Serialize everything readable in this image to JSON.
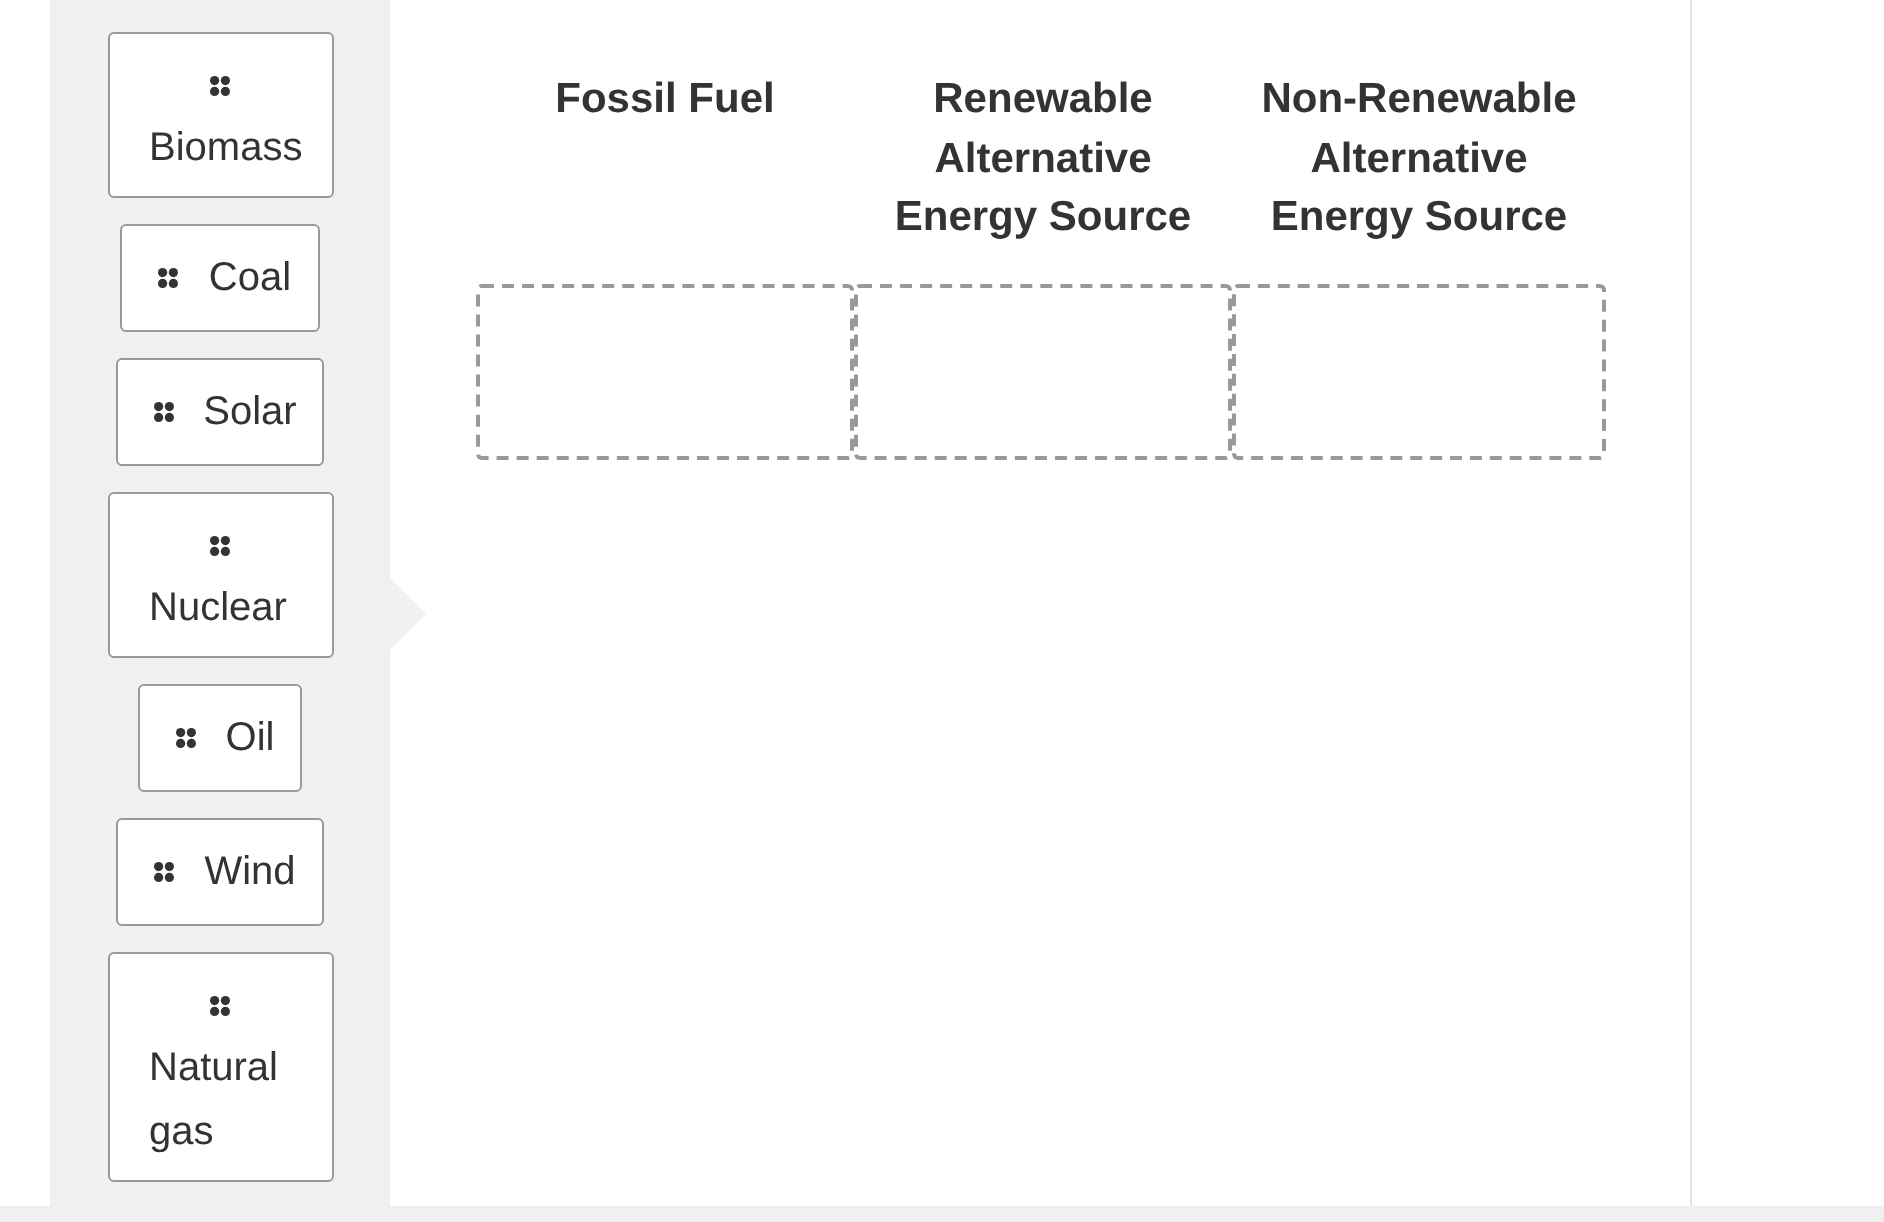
{
  "tiles": [
    {
      "label": "Biomass",
      "kind": "stacked"
    },
    {
      "label": "Coal",
      "kind": "inline"
    },
    {
      "label": "Solar",
      "kind": "inline"
    },
    {
      "label": "Nuclear",
      "kind": "stacked"
    },
    {
      "label": "Oil",
      "kind": "inline"
    },
    {
      "label": "Wind",
      "kind": "inline"
    },
    {
      "label": "Natural gas",
      "kind": "stacked"
    }
  ],
  "columns": [
    {
      "heading": "Fossil Fuel"
    },
    {
      "heading": "Renewable Alternative Energy Source"
    },
    {
      "heading": "Non-Renewable Alternative Energy Source"
    }
  ]
}
